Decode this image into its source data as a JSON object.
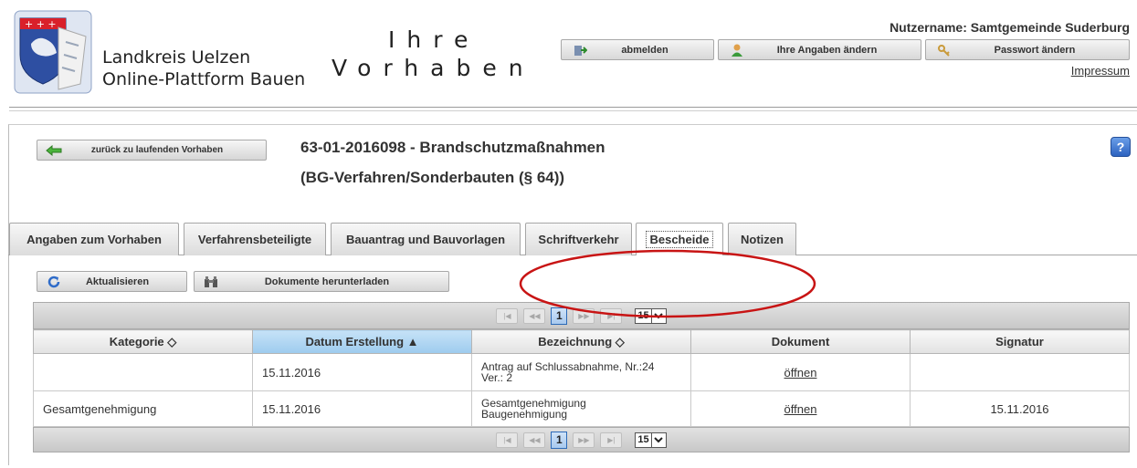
{
  "header": {
    "org_line1": "Landkreis Uelzen",
    "org_line2": "Online-Plattform Bauen",
    "title_line1": "Ihre",
    "title_line2": "Vorhaben",
    "username": "Nutzername: Samtgemeinde Suderburg",
    "buttons": {
      "logout": "abmelden",
      "edit_profile": "Ihre Angaben ändern",
      "change_password": "Passwort ändern"
    },
    "impressum": "Impressum"
  },
  "project": {
    "back_button": "zurück zu laufenden Vorhaben",
    "title": "63-01-2016098 - Brandschutzmaßnahmen",
    "subtitle": "(BG-Verfahren/Sonderbauten (§ 64))",
    "help": "?"
  },
  "tabs": [
    {
      "label": "Angaben zum Vorhaben",
      "active": false
    },
    {
      "label": "Verfahrensbeteiligte",
      "active": false
    },
    {
      "label": "Bauantrag und Bauvorlagen",
      "active": false
    },
    {
      "label": "Schriftverkehr",
      "active": false
    },
    {
      "label": "Bescheide",
      "active": true
    },
    {
      "label": "Notizen",
      "active": false
    }
  ],
  "toolbar": {
    "refresh": "Aktualisieren",
    "download": "Dokumente herunterladen"
  },
  "pager": {
    "current_page": "1",
    "page_size": "15"
  },
  "table": {
    "columns": {
      "kategorie": "Kategorie ◇",
      "datum": "Datum Erstellung ▲",
      "bezeichnung": "Bezeichnung ◇",
      "dokument": "Dokument",
      "signatur": "Signatur"
    },
    "rows": [
      {
        "kategorie": "",
        "datum": "15.11.2016",
        "bez_line1": "Antrag auf Schlussabnahme, Nr.:24",
        "bez_line2": "Ver.: 2",
        "dokument": "öffnen",
        "signatur": ""
      },
      {
        "kategorie": "Gesamtgenehmigung",
        "datum": "15.11.2016",
        "bez_line1": "Gesamtgenehmigung",
        "bez_line2": "Baugenehmigung",
        "dokument": "öffnen",
        "signatur": "15.11.2016"
      }
    ]
  },
  "colors": {
    "accent_blue": "#2c6ab7",
    "annotation_red": "#c81414",
    "sorted_header": "#9dcbee"
  }
}
